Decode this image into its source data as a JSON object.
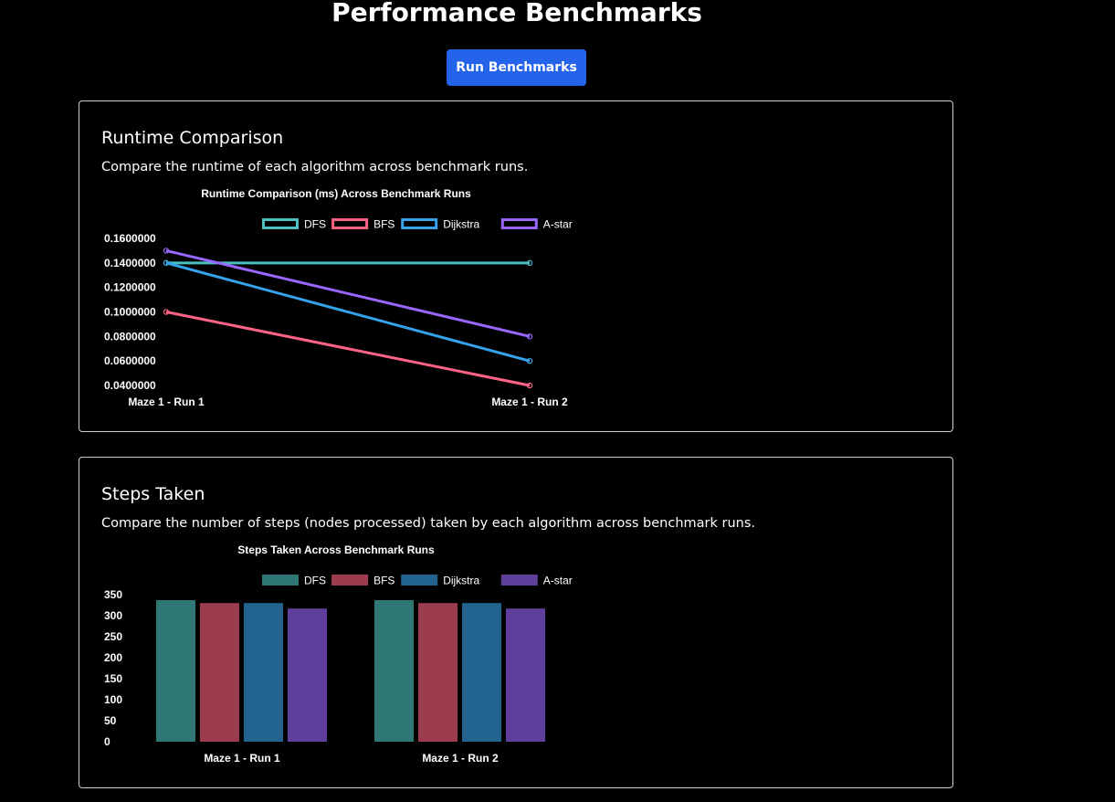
{
  "page": {
    "title": "Performance Benchmarks",
    "run_button_label": "Run Benchmarks"
  },
  "cards": [
    {
      "title": "Runtime Comparison",
      "description": "Compare the runtime of each algorithm across benchmark runs."
    },
    {
      "title": "Steps Taken",
      "description": "Compare the number of steps (nodes processed) taken by each algorithm across benchmark runs."
    }
  ],
  "colors": {
    "DFS": "#4bc0c0",
    "BFS": "#ff6384",
    "Dijkstra": "#36a2eb",
    "A-star": "#9966ff",
    "DFS_fill": "#2e7775",
    "BFS_fill": "#9b3d4f",
    "Dijkstra_fill": "#22648f",
    "A-star_fill": "#5f3f9b",
    "button": "#2563eb"
  },
  "chart_data": [
    {
      "type": "line",
      "title": "Runtime Comparison (ms) Across Benchmark Runs",
      "categories": [
        "Maze 1 - Run 1",
        "Maze 1 - Run 2"
      ],
      "series": [
        {
          "name": "DFS",
          "values": [
            0.14,
            0.14
          ]
        },
        {
          "name": "BFS",
          "values": [
            0.1,
            0.04
          ]
        },
        {
          "name": "Dijkstra",
          "values": [
            0.14,
            0.06
          ]
        },
        {
          "name": "A-star",
          "values": [
            0.15,
            0.08
          ]
        }
      ],
      "y_ticks": [
        "0.1600000",
        "0.1400000",
        "0.1200000",
        "0.1000000",
        "0.0800000",
        "0.0600000",
        "0.0400000"
      ],
      "ylim": [
        0.04,
        0.16
      ],
      "legend": "top",
      "grid": false
    },
    {
      "type": "bar",
      "title": "Steps Taken Across Benchmark Runs",
      "categories": [
        "Maze 1 - Run 1",
        "Maze 1 - Run 2"
      ],
      "series": [
        {
          "name": "DFS",
          "values": [
            337,
            337
          ]
        },
        {
          "name": "BFS",
          "values": [
            330,
            330
          ]
        },
        {
          "name": "Dijkstra",
          "values": [
            330,
            330
          ]
        },
        {
          "name": "A-star",
          "values": [
            317,
            317
          ]
        }
      ],
      "y_ticks": [
        "350",
        "300",
        "250",
        "200",
        "150",
        "100",
        "50",
        "0"
      ],
      "ylim": [
        0,
        350
      ],
      "legend": "top",
      "grid": false
    }
  ]
}
